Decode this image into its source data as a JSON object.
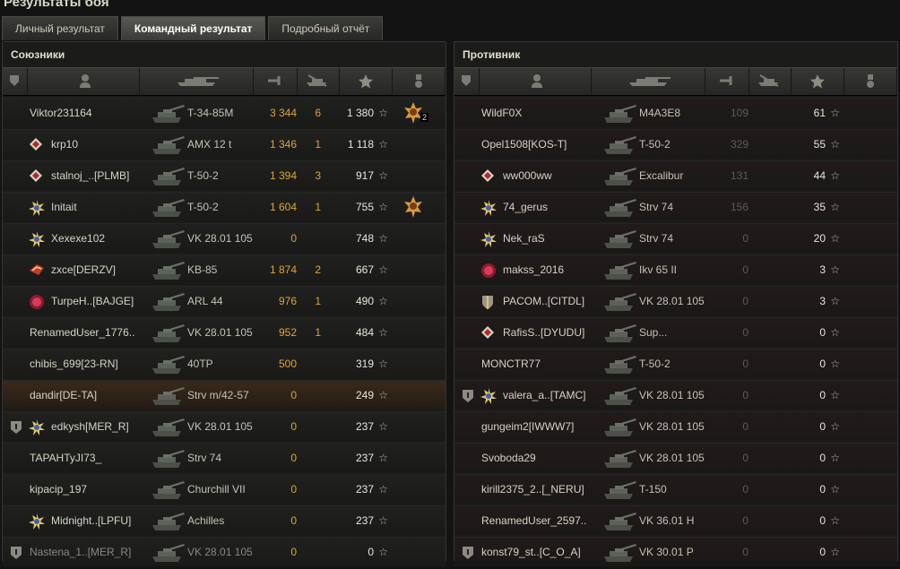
{
  "window": {
    "title": "Результаты боя"
  },
  "tabs": [
    {
      "label": "Личный результат"
    },
    {
      "label": "Командный результат"
    },
    {
      "label": "Подробный отчёт"
    }
  ],
  "allies": {
    "title": "Союзники",
    "rows": [
      {
        "player": "Viktor231164",
        "vehicle": "T-34-85M",
        "damage": "3 344",
        "kills": "6",
        "xp": "1 380",
        "medal": true,
        "medal_count": "2"
      },
      {
        "player": "krp10",
        "vehicle": "AMX 12 t",
        "damage": "1 346",
        "kills": "1",
        "xp": "1 118",
        "badge": "red-diamond"
      },
      {
        "player": "stalnoj_..[PLMB]",
        "vehicle": "T-50-2",
        "damage": "1 394",
        "kills": "3",
        "xp": "917",
        "badge": "red-diamond"
      },
      {
        "player": "Initait",
        "vehicle": "T-50-2",
        "damage": "1 604",
        "kills": "1",
        "xp": "755",
        "badge": "star-burst",
        "medal": true
      },
      {
        "player": "Xexexe102",
        "vehicle": "VK 28.01 105",
        "damage": "0",
        "kills": "",
        "xp": "748",
        "badge": "star-burst"
      },
      {
        "player": "zxce[DERZV]",
        "vehicle": "KB-85",
        "damage": "1 874",
        "kills": "2",
        "xp": "667",
        "badge": "red-emblem"
      },
      {
        "player": "TurpeH..[BAJGE]",
        "vehicle": "ARL 44",
        "damage": "976",
        "kills": "1",
        "xp": "490",
        "badge": "red-circle"
      },
      {
        "player": "RenamedUser_1776..",
        "vehicle": "VK 28.01 105",
        "damage": "952",
        "kills": "1",
        "xp": "484"
      },
      {
        "player": "chibis_699[23-RN]",
        "vehicle": "40TP",
        "damage": "500",
        "kills": "",
        "xp": "319"
      },
      {
        "player": "dandir[DE-TA]",
        "vehicle": "Strv m/42-57",
        "damage": "0",
        "kills": "",
        "xp": "249",
        "highlight": true
      },
      {
        "player": "edkysh[MER_R]",
        "vehicle": "VK 28.01 105",
        "damage": "0",
        "kills": "",
        "xp": "237",
        "badge": "star-burst",
        "platoon": true
      },
      {
        "player": "TAPAHTyJI73_",
        "vehicle": "Strv 74",
        "damage": "0",
        "kills": "",
        "xp": "237"
      },
      {
        "player": "kipacip_197",
        "vehicle": "Churchill VII",
        "damage": "0",
        "kills": "",
        "xp": "237"
      },
      {
        "player": "Midnight..[LPFU]",
        "vehicle": "Achilles",
        "damage": "0",
        "kills": "",
        "xp": "237",
        "badge": "star-burst"
      },
      {
        "player": "Nastena_1..[MER_R]",
        "vehicle": "VK 28.01 105",
        "damage": "0",
        "kills": "",
        "xp": "0",
        "platoon": true,
        "dead": true
      }
    ]
  },
  "enemies": {
    "title": "Противник",
    "rows": [
      {
        "player": "WildF0X",
        "vehicle": "M4A3E8",
        "damage": "109",
        "kills": "",
        "xp": "61"
      },
      {
        "player": "Opel1508[KOS-T]",
        "vehicle": "T-50-2",
        "damage": "329",
        "kills": "",
        "xp": "55"
      },
      {
        "player": "ww000ww",
        "vehicle": "Excalibur",
        "damage": "131",
        "kills": "",
        "xp": "44",
        "badge": "red-diamond"
      },
      {
        "player": "74_gerus",
        "vehicle": "Strv 74",
        "damage": "156",
        "kills": "",
        "xp": "35",
        "badge": "star-burst"
      },
      {
        "player": "Nek_raS",
        "vehicle": "Strv 74",
        "damage": "0",
        "kills": "",
        "xp": "20",
        "badge": "star-burst"
      },
      {
        "player": "makss_2016",
        "vehicle": "Ikv 65 II",
        "damage": "0",
        "kills": "",
        "xp": "3",
        "badge": "red-circle"
      },
      {
        "player": "PACOM..[CITDL]",
        "vehicle": "VK 28.01 105",
        "damage": "0",
        "kills": "",
        "xp": "3",
        "badge": "shield"
      },
      {
        "player": "RafisS..[DYUDU]",
        "vehicle": "Sup...",
        "damage": "0",
        "kills": "",
        "xp": "0",
        "badge": "red-diamond"
      },
      {
        "player": "MONCTR77",
        "vehicle": "T-50-2",
        "damage": "0",
        "kills": "",
        "xp": "0"
      },
      {
        "player": "valera_a..[TAMC]",
        "vehicle": "VK 28.01 105",
        "damage": "0",
        "kills": "",
        "xp": "0",
        "badge": "star-burst",
        "platoon": true
      },
      {
        "player": "gungeim2[IWWW7]",
        "vehicle": "VK 28.01 105",
        "damage": "0",
        "kills": "",
        "xp": "0"
      },
      {
        "player": "Svoboda29",
        "vehicle": "VK 28.01 105",
        "damage": "0",
        "kills": "",
        "xp": "0"
      },
      {
        "player": "kirill2375_2..[_NERU]",
        "vehicle": "T-150",
        "damage": "0",
        "kills": "",
        "xp": "0"
      },
      {
        "player": "RenamedUser_2597..",
        "vehicle": "VK 36.01 H",
        "damage": "0",
        "kills": "",
        "xp": "0"
      },
      {
        "player": "konst79_st..[C_O_A]",
        "vehicle": "VK 30.01 P",
        "damage": "0",
        "kills": "",
        "xp": "0",
        "platoon": true
      }
    ]
  }
}
